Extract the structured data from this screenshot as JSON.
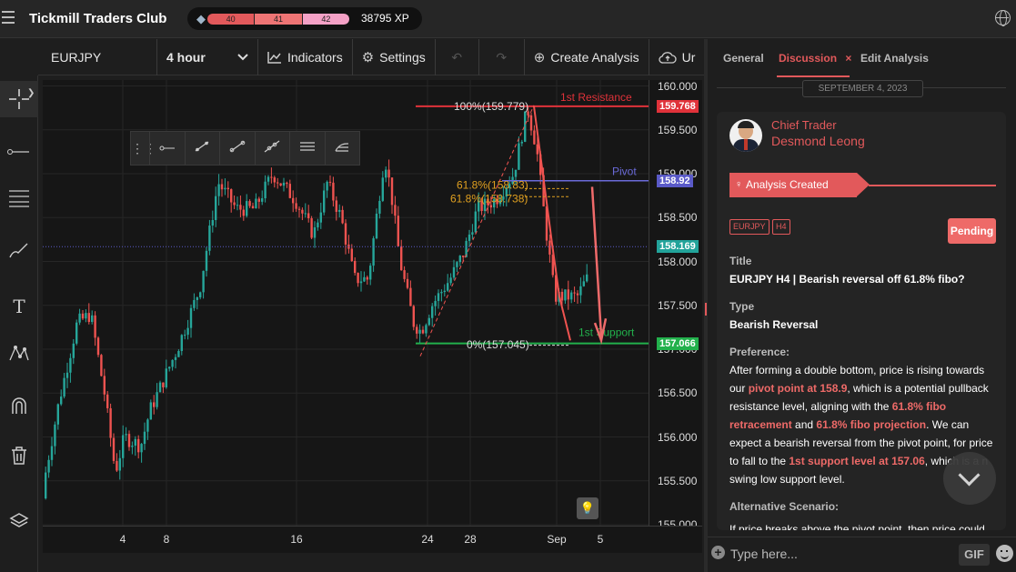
{
  "app": {
    "title": "Tickmill Traders Club",
    "levels": [
      "40",
      "41",
      "42"
    ],
    "xp": "38795 XP"
  },
  "toolbar": {
    "symbol": "EURJPY",
    "timeframe": "4 hour",
    "indicators": "Indicators",
    "settings": "Settings",
    "create_analysis": "Create Analysis",
    "upload": "Ur"
  },
  "left_tools": [
    "crosshair-icon",
    "horizontal-line-icon",
    "fib-levels-icon",
    "brush-icon",
    "text-icon",
    "pattern-icon",
    "magnet-icon",
    "trash-icon",
    "layers-icon"
  ],
  "drawing_tools": [
    "horizontal-ray-icon",
    "trend-line-icon",
    "line-icon",
    "extended-line-icon",
    "parallel-channel-icon",
    "fib-channel-icon"
  ],
  "chart_data": {
    "type": "candlestick",
    "symbol": "EURJPY",
    "timeframe": "4 hour",
    "y_ticks": [
      "160.000",
      "159.500",
      "159.000",
      "158.500",
      "158.000",
      "157.500",
      "157.000",
      "156.500",
      "156.000",
      "155.500",
      "155.000"
    ],
    "ylim": [
      155.0,
      160.0
    ],
    "x_ticks": [
      "4",
      "8",
      "16",
      "24",
      "28",
      "Sep",
      "5"
    ],
    "price_badges": [
      {
        "value": "159.768",
        "color": "#e0323a"
      },
      {
        "value": "158.92",
        "color": "#5a5ac8"
      },
      {
        "value": "158.169",
        "color": "#22a39a"
      },
      {
        "value": "157.066",
        "color": "#22b14c"
      }
    ],
    "levels": [
      {
        "label": "1st Resistance",
        "price": 159.768,
        "color": "#e0323a"
      },
      {
        "label": "Pivot",
        "price": 158.92,
        "color": "#6a6ad8"
      },
      {
        "label": "1st Support",
        "price": 157.066,
        "color": "#22b14c"
      }
    ],
    "fib_labels": [
      {
        "label": "100%(159.779)",
        "price": 159.779
      },
      {
        "label": "61.8%(158.83)",
        "price": 158.83
      },
      {
        "label": "61.8%(158.738)",
        "price": 158.738
      },
      {
        "label": "0%(157.045)",
        "price": 157.045
      }
    ],
    "current_price": 158.169
  },
  "panel": {
    "tabs": [
      "General",
      "Discussion",
      "Edit Analysis"
    ],
    "tab_close": "×",
    "date": "SEPTEMBER 4, 2023",
    "role": "Chief Trader",
    "name": "Desmond Leong",
    "event": "Analysis Created",
    "tags": [
      "EURJPY",
      "H4"
    ],
    "status": "Pending",
    "title_label": "Title",
    "title_value": "EURJPY H4 | Bearish reversal off 61.8% fibo?",
    "type_label": "Type",
    "type_value": "Bearish Reversal",
    "pref_label": "Preference:",
    "pref_1": "After forming a double bottom, price is rising towards our ",
    "pref_hl1": "pivot point at 158.9",
    "pref_2": ", which is a potential pullback resistance level, aligning with the ",
    "pref_hl2": "61.8% fibo retracement",
    "pref_3": " and ",
    "pref_hl3": "61.8% fibo projection",
    "pref_4": ". We can expect a bearish reversal from the pivot point, for price to fall to the ",
    "pref_hl4": "1st support level at 157.06",
    "pref_5": ", which is a n",
    "pref_6": "swing low support level.",
    "alt_label": "Alternative Scenario:",
    "alt_value": "If price breaks above the pivot point, then price could"
  },
  "composer": {
    "placeholder": "Type here...",
    "gif": "GIF"
  }
}
